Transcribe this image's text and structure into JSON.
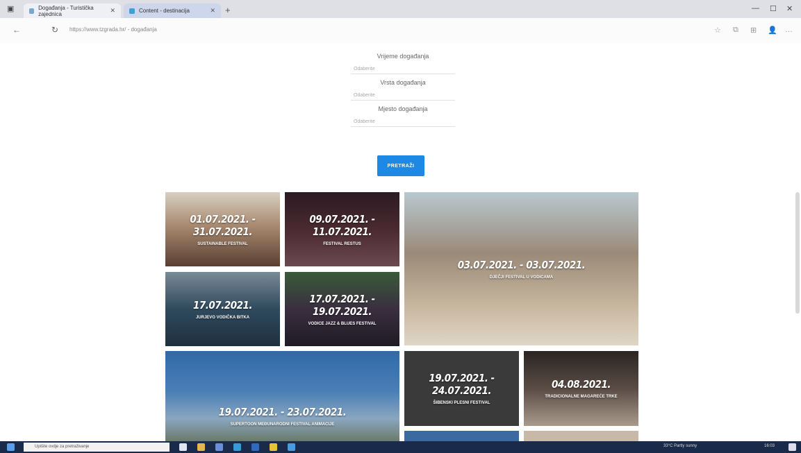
{
  "browser": {
    "tabs": [
      {
        "label": "Događanja - Turistička zajednica"
      },
      {
        "label": "Content - destinacija"
      }
    ],
    "url": "https://www.tzgrada.hr/ - događanja"
  },
  "form": {
    "fields": [
      {
        "label": "Vrijeme događanja",
        "placeholder": "Odaberite"
      },
      {
        "label": "Vrsta događanja",
        "placeholder": "Odaberite"
      },
      {
        "label": "Mjesto događanja",
        "placeholder": "Odaberite"
      }
    ],
    "search_button": "PRETRAŽI"
  },
  "events": [
    {
      "date": "01.07.2021. - 31.07.2021.",
      "title": "SUSTAINABLE FESTIVAL",
      "color": "#a88a70"
    },
    {
      "date": "09.07.2021. - 11.07.2021.",
      "title": "FESTIVAL RESTUS",
      "color": "#4a2a30"
    },
    {
      "date": "03.07.2021. - 03.07.2021.",
      "title": "DJEČJI FESTIVAL U VODICAMA",
      "color": "#9a8a78"
    },
    {
      "date": "17.07.2021.",
      "title": "JURJEVO VODIČKA BITKA",
      "color": "#2f4a5e"
    },
    {
      "date": "17.07.2021. - 19.07.2021.",
      "title": "VODICE JAZZ & BLUES FESTIVAL",
      "color": "#3a2f3f"
    },
    {
      "date": "19.07.2021. - 23.07.2021.",
      "title": "SUPERTOON MEĐUNARODNI FESTIVAL ANIMACIJE",
      "color": "#4a7fb5"
    },
    {
      "date": "19.07.2021. - 24.07.2021.",
      "title": "ŠIBENSKI PLESNI FESTIVAL",
      "color": "#3a3a3a"
    },
    {
      "date": "04.08.2021.",
      "title": "TRADICIONALNE MAGAREĆE TRKE",
      "color": "#5a4c44"
    }
  ],
  "taskbar": {
    "search_placeholder": "Upišite ovdje za pretraživanje",
    "weather": "33°C Partly sunny",
    "time": "16:03"
  }
}
